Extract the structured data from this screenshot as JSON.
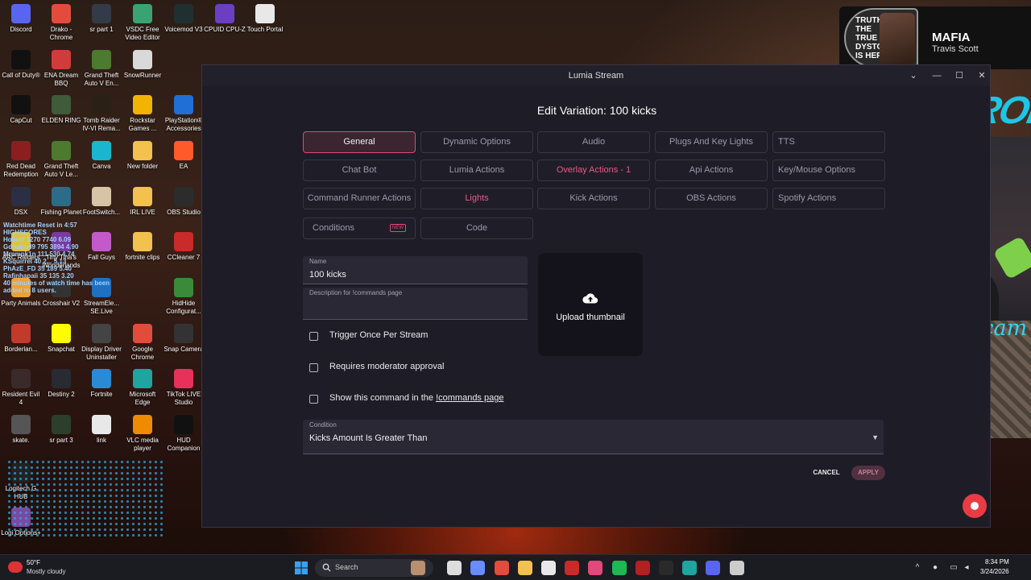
{
  "desktop": {
    "icons": [
      {
        "label": "Discord",
        "color": "#5865f2"
      },
      {
        "label": "Drako - Chrome",
        "color": "#e34c3c"
      },
      {
        "label": "sr part 1",
        "color": "#333a48"
      },
      {
        "label": "VSDC Free Video Editor",
        "color": "#3aa374"
      },
      {
        "label": "Voicemod V3",
        "color": "#203030"
      },
      {
        "label": "CPUID CPU-Z",
        "color": "#6b3fc1"
      },
      {
        "label": "Touch Portal",
        "color": "#e8e8e8"
      },
      {
        "label": "Call of Duty®",
        "color": "#111111"
      },
      {
        "label": "ENA Dream BBQ",
        "color": "#d23b3b"
      },
      {
        "label": "Grand Theft Auto V En...",
        "color": "#4c7a2e"
      },
      {
        "label": "SnowRunner",
        "color": "#d9d9d9"
      },
      {
        "label": "CapCut",
        "color": "#111111"
      },
      {
        "label": "ELDEN RING",
        "color": "#3e5b3a"
      },
      {
        "label": "Tomb Raider IV-VI Rema...",
        "color": "#2a2016"
      },
      {
        "label": "Rockstar Games ...",
        "color": "#f2b400"
      },
      {
        "label": "PlayStation® Accessories",
        "color": "#1f6fd6"
      },
      {
        "label": "Red Dead Redemption",
        "color": "#8b1f1f"
      },
      {
        "label": "Grand Theft Auto V Le...",
        "color": "#4c7a2e"
      },
      {
        "label": "Canva",
        "color": "#19b7cf"
      },
      {
        "label": "New folder",
        "color": "#f2c14e"
      },
      {
        "label": "EA",
        "color": "#ff5a2a"
      },
      {
        "label": "DSX",
        "color": "#2b2f44"
      },
      {
        "label": "Fishing Planet",
        "color": "#2b6d88"
      },
      {
        "label": "FootSwitch...",
        "color": "#d7c3a6"
      },
      {
        "label": "IRL LIVE",
        "color": "#f2c14e"
      },
      {
        "label": "OBS Studio",
        "color": "#2c2c2c"
      },
      {
        "label": "ARC Raiders",
        "color": "#e0c23b"
      },
      {
        "label": "Tiny Tina's Wonderlands",
        "color": "#7a3aa0"
      },
      {
        "label": "Fall Guys",
        "color": "#c45ac9"
      },
      {
        "label": "fortnite clips",
        "color": "#f2c14e"
      },
      {
        "label": "CCleaner 7",
        "color": "#c92a2a"
      },
      {
        "label": "Party Animals",
        "color": "#f0a030"
      },
      {
        "label": "Crosshair V2",
        "color": "#333333"
      },
      {
        "label": "StreamEle... SE.Live",
        "color": "#1f70c1"
      },
      {
        "label": "HidHide Configurat...",
        "color": "#3a8a3a"
      },
      {
        "label": "Borderlan...",
        "color": "#c23a2a"
      },
      {
        "label": "Snapchat",
        "color": "#fffc00"
      },
      {
        "label": "Display Driver Uninstaller",
        "color": "#444444"
      },
      {
        "label": "Google Chrome",
        "color": "#e34c3c"
      },
      {
        "label": "Snap Camera",
        "color": "#333333"
      },
      {
        "label": "Resident Evil 4",
        "color": "#3a2a2a"
      },
      {
        "label": "Destiny 2",
        "color": "#2a2a33"
      },
      {
        "label": "Fortnite",
        "color": "#2a8ad6"
      },
      {
        "label": "Microsoft Edge",
        "color": "#1fa4a0"
      },
      {
        "label": "TikTok LIVE Studio",
        "color": "#e8305a"
      },
      {
        "label": "skate.",
        "color": "#555555"
      },
      {
        "label": "sr part 3",
        "color": "#2c3e2c"
      },
      {
        "label": "link",
        "color": "#e8e8e8"
      },
      {
        "label": "VLC media player",
        "color": "#f08a00"
      },
      {
        "label": "HUD Companion",
        "color": "#111111"
      },
      {
        "label": "Logitech G HUB",
        "color": "#222222"
      },
      {
        "label": "Logi Options+",
        "color": "#7a4aa0"
      }
    ],
    "widget_lines": [
      "Watchtime Reset in 4:57",
      "HIGHSCORES",
      "Hollaiii 1270 7740 6.09",
      "Gdnatro89 795 3894 4.90",
      "Mrpmpk1n 111 530 4.74",
      "KSquirrel 40 2... 5.13",
      "PhAzE_FD 35 189 5.40",
      "Rafinhapaii 35 135 3.20",
      "40 minutes of watch time has been",
      "added to 8 users."
    ]
  },
  "now_playing": {
    "album_text": "TRUTHS THE TRUE DYSTOPIA IS HERE!",
    "title": "MAFIA",
    "artist": "Travis Scott"
  },
  "overlay": {
    "brand_logo": "AZERON",
    "cam_label": "Juno cam"
  },
  "window": {
    "title": "Lumia Stream",
    "controls": {
      "collapse": "⌄",
      "minimize": "—",
      "maximize": "☐",
      "close": "✕"
    }
  },
  "dialog": {
    "title": "Edit Variation: 100 kicks",
    "tabs": [
      {
        "label": "General",
        "state": "active"
      },
      {
        "label": "Dynamic Options",
        "state": "normal"
      },
      {
        "label": "Audio",
        "state": "normal"
      },
      {
        "label": "Plugs And Key Lights",
        "state": "normal"
      },
      {
        "label": "TTS",
        "state": "normal"
      },
      {
        "label": "Chat Bot",
        "state": "normal"
      },
      {
        "label": "Lumia Actions",
        "state": "normal"
      },
      {
        "label": "Overlay Actions - 1",
        "state": "highlighted"
      },
      {
        "label": "Api Actions",
        "state": "normal"
      },
      {
        "label": "Key/Mouse Options",
        "state": "normal"
      },
      {
        "label": "Command Runner Actions",
        "state": "normal"
      },
      {
        "label": "Lights",
        "state": "highlighted"
      },
      {
        "label": "Kick Actions",
        "state": "normal"
      },
      {
        "label": "OBS Actions",
        "state": "normal"
      },
      {
        "label": "Spotify Actions",
        "state": "normal"
      },
      {
        "label": "Conditions",
        "state": "normal",
        "badge": "NEW"
      },
      {
        "label": "Code",
        "state": "normal"
      }
    ],
    "name_field": {
      "label": "Name",
      "value": "100 kicks"
    },
    "description_field": {
      "label": "Description for !commands page",
      "value": ""
    },
    "upload": {
      "label": "Upload thumbnail",
      "icon": "cloud-upload-icon"
    },
    "checkboxes": [
      {
        "label": "Trigger Once Per Stream",
        "checked": false
      },
      {
        "label": "Requires moderator approval",
        "checked": false
      },
      {
        "label": "Show this command in the ",
        "link": "!commands page",
        "checked": false
      }
    ],
    "condition_field": {
      "label": "Condition",
      "value": "Kicks Amount Is Greater Than"
    },
    "buttons": {
      "cancel": "CANCEL",
      "apply": "APPLY"
    }
  },
  "taskbar": {
    "weather": {
      "temp": "50°F",
      "desc": "Mostly cloudy"
    },
    "search_label": "Search",
    "apps": [
      {
        "name": "search-decor-icon",
        "color": "#b89070"
      },
      {
        "name": "task-view-icon",
        "color": "#dddddd"
      },
      {
        "name": "copilot-icon",
        "color": "#6a8cff"
      },
      {
        "name": "chrome-icon",
        "color": "#e34c3c"
      },
      {
        "name": "file-explorer-icon",
        "color": "#f2c14e"
      },
      {
        "name": "store-icon",
        "color": "#e8e8e8"
      },
      {
        "name": "app-red-icon",
        "color": "#c92a2a"
      },
      {
        "name": "lumia-icon",
        "color": "#e2487a"
      },
      {
        "name": "spotify-icon",
        "color": "#1db954"
      },
      {
        "name": "app-red2-icon",
        "color": "#b32020"
      },
      {
        "name": "xbox-icon",
        "color": "#2a2a2a"
      },
      {
        "name": "edge-icon",
        "color": "#1fa4a0"
      },
      {
        "name": "discord-icon",
        "color": "#5865f2"
      },
      {
        "name": "obs-icon",
        "color": "#cccccc"
      }
    ],
    "clock": {
      "time": "8:34 PM",
      "date": "3/24/2026"
    }
  }
}
